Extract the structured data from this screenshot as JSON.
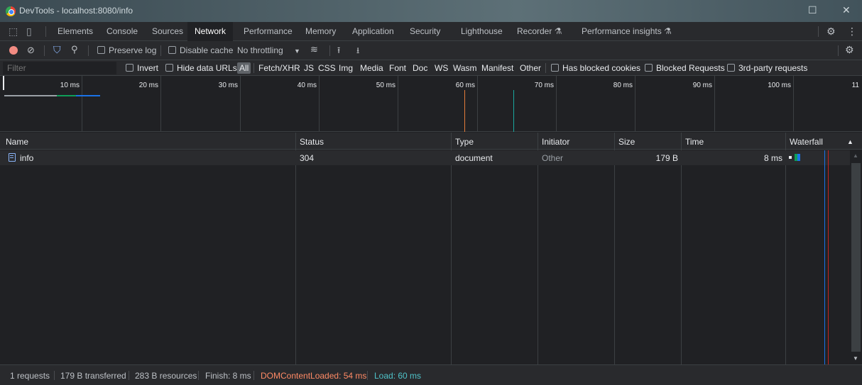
{
  "window": {
    "title": "DevTools - localhost:8080/info"
  },
  "tabs": [
    "Elements",
    "Console",
    "Sources",
    "Network",
    "Performance",
    "Memory",
    "Application",
    "Security",
    "Lighthouse",
    "Recorder",
    "Performance insights"
  ],
  "active_tab": "Network",
  "toolbar": {
    "preserve_log": "Preserve log",
    "disable_cache": "Disable cache",
    "throttling": "No throttling"
  },
  "filter": {
    "placeholder": "Filter",
    "invert": "Invert",
    "hide_data_urls": "Hide data URLs",
    "types": [
      "All",
      "Fetch/XHR",
      "JS",
      "CSS",
      "Img",
      "Media",
      "Font",
      "Doc",
      "WS",
      "Wasm",
      "Manifest",
      "Other"
    ],
    "has_blocked_cookies": "Has blocked cookies",
    "blocked_requests": "Blocked Requests",
    "third_party": "3rd-party requests"
  },
  "overview": {
    "ticks": [
      "10 ms",
      "20 ms",
      "30 ms",
      "40 ms",
      "50 ms",
      "60 ms",
      "70 ms",
      "80 ms",
      "90 ms",
      "100 ms",
      "11"
    ]
  },
  "table": {
    "columns": [
      "Name",
      "Status",
      "Type",
      "Initiator",
      "Size",
      "Time",
      "Waterfall"
    ],
    "rows": [
      {
        "name": "info",
        "status": "304",
        "type": "document",
        "initiator": "Other",
        "size": "179 B",
        "time": "8 ms"
      }
    ]
  },
  "status": {
    "requests": "1 requests",
    "transferred": "179 B transferred",
    "resources": "283 B resources",
    "finish": "Finish: 8 ms",
    "dom_content_loaded": "DOMContentLoaded: 54 ms",
    "load": "Load: 60 ms"
  },
  "colors": {
    "dcl": "#ff8a65",
    "load": "#4fc3c9",
    "record": "#f28b82",
    "accent": "#8ab4f8"
  }
}
